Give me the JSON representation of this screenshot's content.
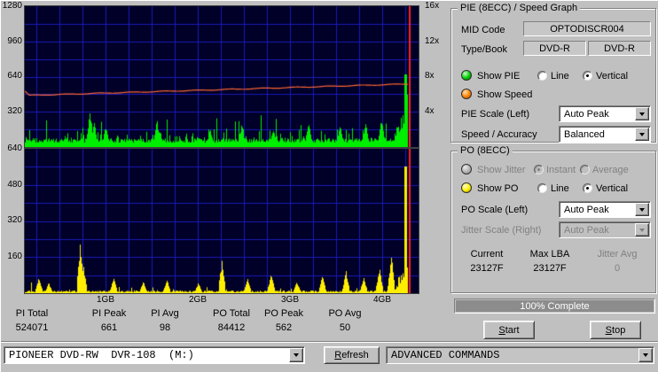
{
  "graph": {
    "pie_yticks": [
      "1280",
      "960",
      "640",
      "320"
    ],
    "po_yticks": [
      "640",
      "480",
      "320",
      "160"
    ],
    "speed_yticks": [
      "16x",
      "12x",
      "8x",
      "4x"
    ],
    "xticks": [
      "1GB",
      "2GB",
      "3GB",
      "4GB"
    ],
    "colors": {
      "bg": "#000028",
      "grid": "#1a1ab8",
      "pie": "#00ee00",
      "po": "#ffee00",
      "speed": "#ff6633",
      "cursor": "#ff2020"
    },
    "cursor_pos": 0.9755,
    "data_end": 0.972,
    "pie_end_peak": 82,
    "po_end_peak": 143,
    "pie_peaks": [
      [
        0.165,
        42
      ],
      [
        0.175,
        30
      ],
      [
        0.205,
        25
      ],
      [
        0.335,
        32
      ],
      [
        0.47,
        22
      ],
      [
        0.55,
        27
      ],
      [
        0.63,
        22
      ],
      [
        0.72,
        30
      ],
      [
        0.8,
        25
      ],
      [
        0.865,
        28
      ],
      [
        0.905,
        34
      ]
    ],
    "po_peaks": [
      [
        0.035,
        18
      ],
      [
        0.06,
        12
      ],
      [
        0.14,
        58
      ],
      [
        0.148,
        32
      ],
      [
        0.225,
        20
      ],
      [
        0.3,
        14
      ],
      [
        0.36,
        16
      ],
      [
        0.44,
        12
      ],
      [
        0.5,
        38
      ],
      [
        0.565,
        18
      ],
      [
        0.625,
        24
      ],
      [
        0.69,
        14
      ],
      [
        0.755,
        20
      ],
      [
        0.815,
        26
      ],
      [
        0.86,
        18
      ],
      [
        0.9,
        30
      ],
      [
        0.93,
        44
      ]
    ]
  },
  "stats": {
    "items": [
      {
        "label": "PI Total",
        "value": "524071"
      },
      {
        "label": "PI Peak",
        "value": "661"
      },
      {
        "label": "PI Avg",
        "value": "98"
      },
      {
        "label": "PO Total",
        "value": "84412"
      },
      {
        "label": "PO Peak",
        "value": "562"
      },
      {
        "label": "PO Avg",
        "value": "50"
      }
    ]
  },
  "bottom": {
    "drive": "PIONEER DVD-RW  DVR-108  (M:)",
    "refresh": "Refresh",
    "advanced": "ADVANCED COMMANDS"
  },
  "pie_panel": {
    "title": "PIE (8ECC) / Speed Graph",
    "mid_label": "MID Code",
    "mid_value": "OPTODISCR004",
    "type_label": "Type/Book",
    "type_value_1": "DVD-R",
    "type_value_2": "DVD-R",
    "show_pie": "Show PIE",
    "line": "Line",
    "vertical": "Vertical",
    "show_speed": "Show Speed",
    "pie_scale_label": "PIE Scale (Left)",
    "pie_scale_value": "Auto Peak",
    "speed_accuracy_label": "Speed / Accuracy",
    "speed_accuracy_value": "Balanced"
  },
  "po_panel": {
    "title": "PO (8ECC)",
    "show_jitter": "Show Jitter",
    "instant": "Instant",
    "average": "Average",
    "show_po": "Show PO",
    "line": "Line",
    "vertical": "Vertical",
    "po_scale_label": "PO Scale (Left)",
    "po_scale_value": "Auto Peak",
    "jitter_scale_label": "Jitter Scale (Right)",
    "jitter_scale_value": "Auto Peak",
    "current_label": "Current",
    "current_value": "23127F",
    "max_lba_label": "Max LBA",
    "max_lba_value": "23127F",
    "jitter_avg_label": "Jitter Avg",
    "jitter_avg_value": "0",
    "progress": "100% Complete",
    "start": "Start",
    "stop": "Stop"
  }
}
